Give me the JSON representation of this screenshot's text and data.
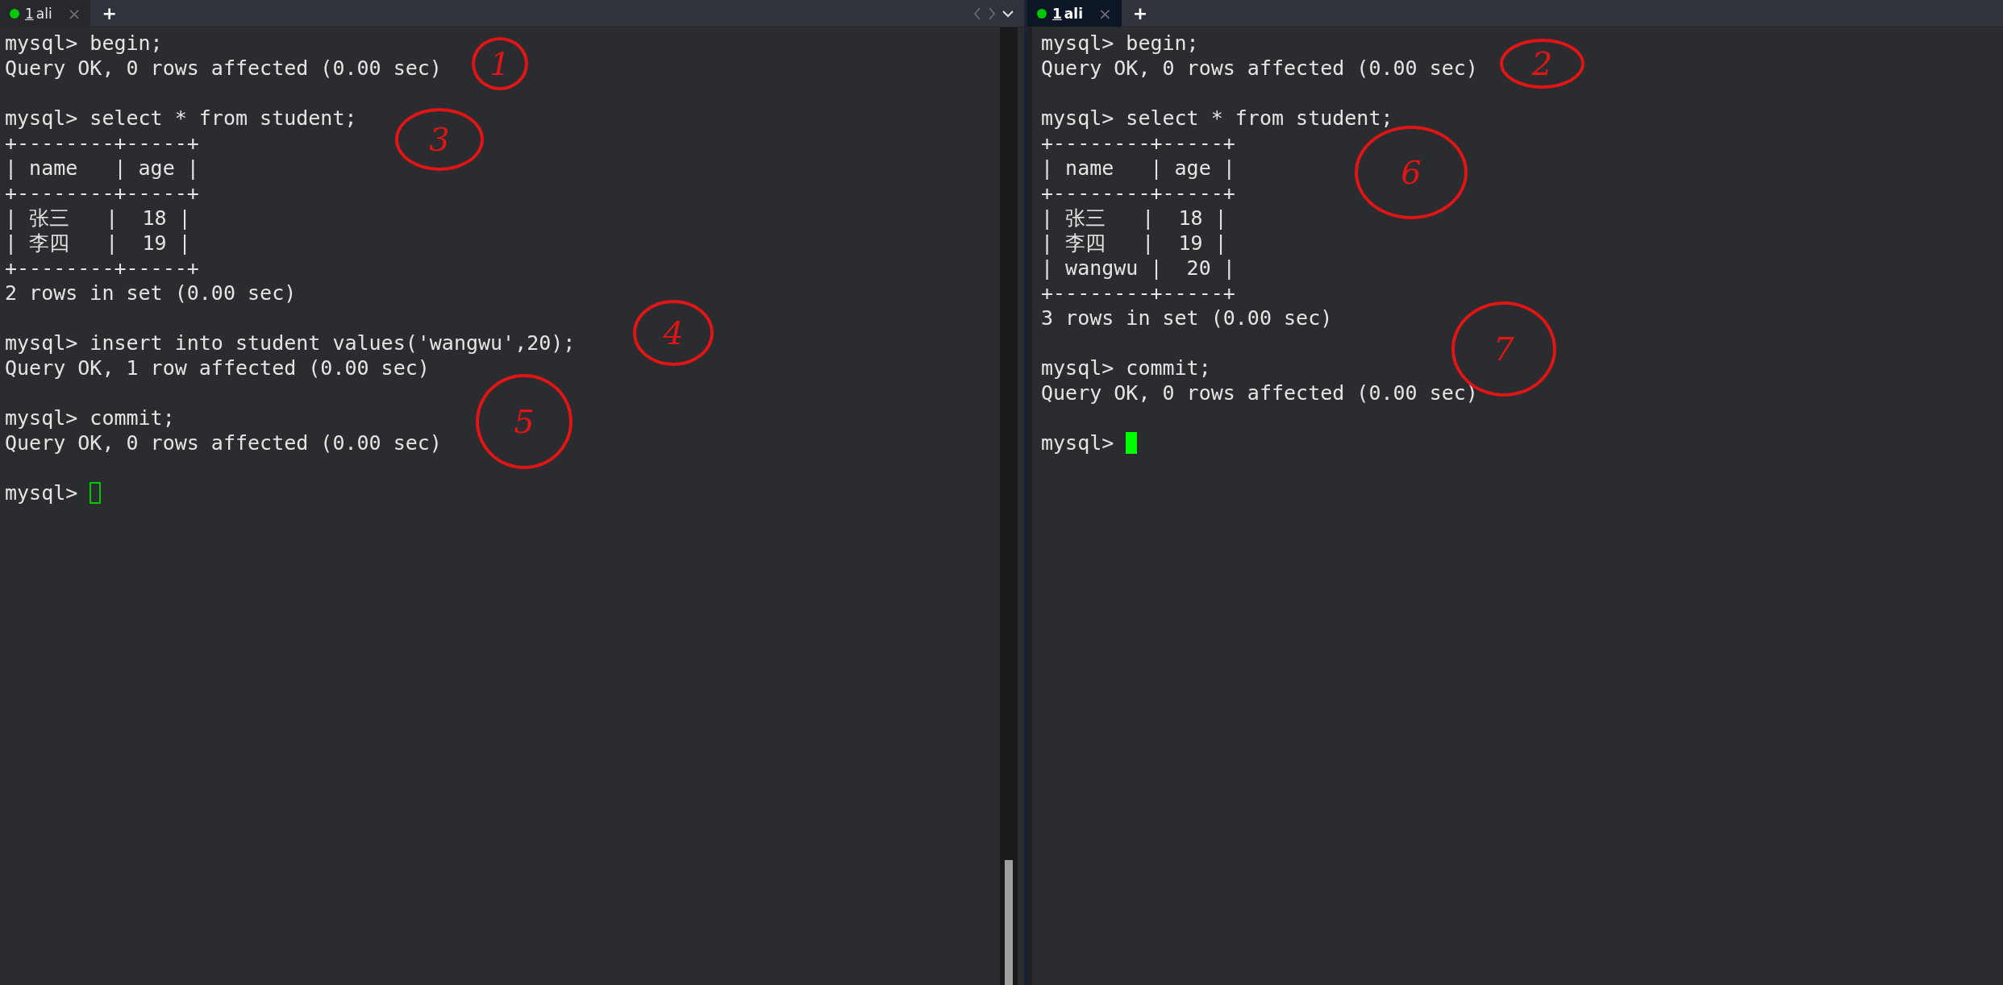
{
  "panes": [
    {
      "focused": false,
      "tab": {
        "number": "1",
        "title": "ali",
        "close": "×",
        "selected": false
      },
      "new_tab": "+",
      "blocks": [
        [
          "mysql> begin;",
          "Query OK, 0 rows affected (0.00 sec)"
        ],
        [
          "mysql> select * from student;",
          "+--------+-----+",
          "| name   | age |",
          "+--------+-----+",
          "| 张三   |  18 |",
          "| 李四   |  19 |",
          "+--------+-----+",
          "2 rows in set (0.00 sec)"
        ],
        [
          "mysql> insert into student values('wangwu',20);",
          "Query OK, 1 row affected (0.00 sec)"
        ],
        [
          "mysql> commit;",
          "Query OK, 0 rows affected (0.00 sec)"
        ]
      ],
      "prompt": "mysql>",
      "annotations": [
        "1",
        "3",
        "4",
        "5"
      ]
    },
    {
      "focused": true,
      "tab": {
        "number": "1",
        "title": "ali",
        "close": "×",
        "selected": true
      },
      "new_tab": "+",
      "blocks": [
        [
          "mysql> begin;",
          "Query OK, 0 rows affected (0.00 sec)"
        ],
        [
          "mysql> select * from student;",
          "+--------+-----+",
          "| name   | age |",
          "+--------+-----+",
          "| 张三   |  18 |",
          "| 李四   |  19 |",
          "| wangwu |  20 |",
          "+--------+-----+",
          "3 rows in set (0.00 sec)"
        ],
        [
          "mysql> commit;",
          "Query OK, 0 rows affected (0.00 sec)"
        ]
      ],
      "prompt": "mysql>",
      "annotations": [
        "2",
        "6",
        "7"
      ]
    }
  ]
}
